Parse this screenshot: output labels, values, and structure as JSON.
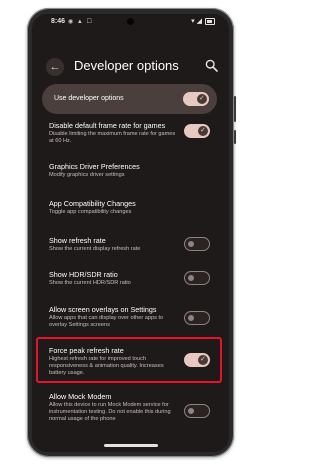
{
  "status_bar": {
    "time": "8:46",
    "left_icons": "◉ ▲ ☐",
    "right_icons": "▾ ◢"
  },
  "app_bar": {
    "back_glyph": "←",
    "title": "Developer options",
    "search_icon": "search-icon"
  },
  "master_toggle": {
    "label": "Use developer options",
    "state": "on"
  },
  "settings": [
    {
      "id": "disable-default-frame-rate",
      "title": "Disable default frame rate for games",
      "description": "Disable limiting the maximum frame rate for games at 60 Hz.",
      "toggle": "on"
    },
    {
      "id": "graphics-driver-preferences",
      "title": "Graphics Driver Preferences",
      "description": "Modify graphics driver settings",
      "toggle": null
    },
    {
      "id": "app-compatibility-changes",
      "title": "App Compatibility Changes",
      "description": "Toggle app compatibility changes",
      "toggle": null
    },
    {
      "id": "show-refresh-rate",
      "title": "Show refresh rate",
      "description": "Show the current display refresh rate",
      "toggle": "off"
    },
    {
      "id": "show-hdr-sdr-ratio",
      "title": "Show HDR/SDR ratio",
      "description": "Show the current HDR/SDR ratio",
      "toggle": "off"
    },
    {
      "id": "allow-screen-overlays",
      "title": "Allow screen overlays on Settings",
      "description": "Allow apps that can display over other apps to overlay Settings screens",
      "toggle": "off"
    },
    {
      "id": "force-peak-refresh-rate",
      "title": "Force peak refresh rate",
      "description": "Highest refresh rate for improved touch responsiveness & animation quality. Increases battery usage.",
      "toggle": "on",
      "highlighted": true
    },
    {
      "id": "allow-mock-modem",
      "title": "Allow Mock Modem",
      "description": "Allow this device to run Mock Modem service for instrumentation testing. Do not enable this during normal usage of the phone",
      "toggle": "off"
    }
  ],
  "colors": {
    "highlight": "#e8132a",
    "toggle_on": "#e8c9c2",
    "screen_bg": "#1e1a19"
  }
}
